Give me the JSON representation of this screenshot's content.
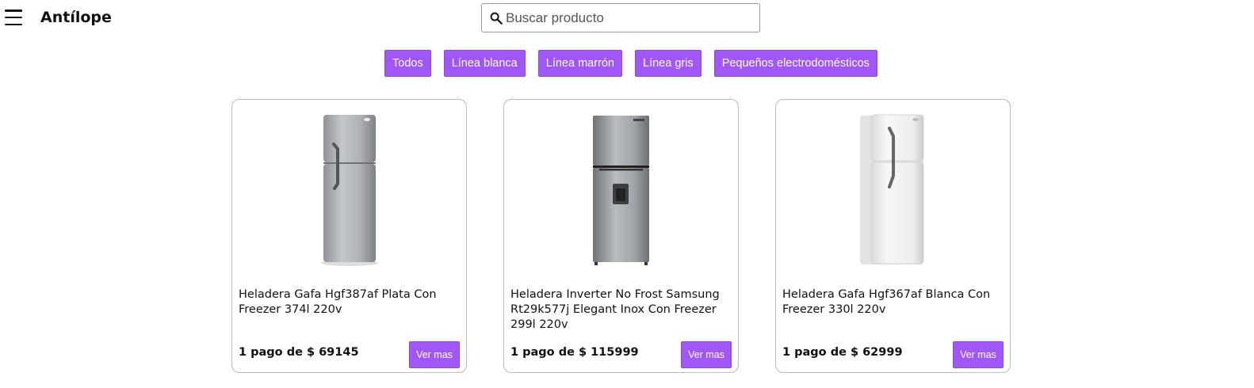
{
  "header": {
    "brand": "Antílope",
    "menu_icon": "hamburger-icon",
    "search": {
      "placeholder": "Buscar producto",
      "value": "",
      "icon": "search-icon"
    }
  },
  "categories": [
    "Todos",
    "Línea blanca",
    "Línea marrón",
    "Línea gris",
    "Pequeños electrodomésticos"
  ],
  "accent_color": "#a156f7",
  "products": [
    {
      "title": "Heladera Gafa Hgf387af Plata Con Freezer 374l 220v",
      "price": "1 pago de $ 69145",
      "action": "Ver mas",
      "image": "refrigerator-silver-icon"
    },
    {
      "title": "Heladera Inverter No Frost Samsung Rt29k577j Elegant Inox Con Freezer 299l 220v",
      "price": "1 pago de $ 115999",
      "action": "Ver mas",
      "image": "refrigerator-inox-dispenser-icon"
    },
    {
      "title": "Heladera Gafa Hgf367af Blanca Con Freezer 330l 220v",
      "price": "1 pago de $ 62999",
      "action": "Ver mas",
      "image": "refrigerator-white-icon"
    }
  ]
}
